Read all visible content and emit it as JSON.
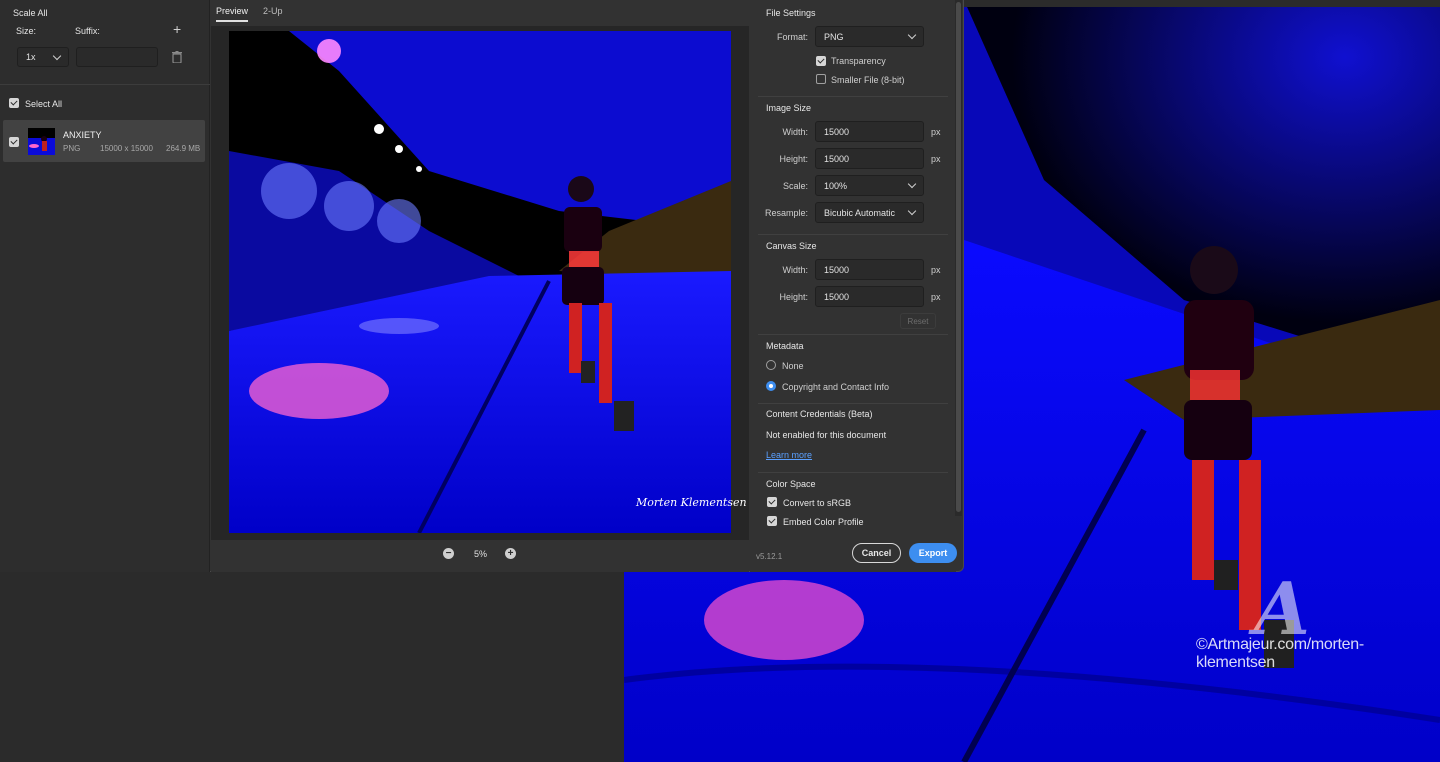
{
  "watermark": "©Artmajeur.com/morten-klementsen",
  "left_panel": {
    "scale_all": "Scale All",
    "size_label": "Size:",
    "suffix_label": "Suffix:",
    "size_value": "1x",
    "suffix_value": "",
    "select_all": "Select All",
    "asset": {
      "name": "ANXIETY",
      "format": "PNG",
      "dimensions": "15000 x 15000",
      "filesize": "264.9 MB"
    }
  },
  "tabs": [
    "Preview",
    "2-Up"
  ],
  "zoom": "5%",
  "signature": "Morten Klementsen",
  "file_settings": {
    "title": "File Settings",
    "format_label": "Format:",
    "format_value": "PNG",
    "transparency": "Transparency",
    "smaller_file": "Smaller File (8-bit)"
  },
  "image_size": {
    "title": "Image Size",
    "width_label": "Width:",
    "width_value": "15000",
    "height_label": "Height:",
    "height_value": "15000",
    "unit": "px",
    "scale_label": "Scale:",
    "scale_value": "100%",
    "resample_label": "Resample:",
    "resample_value": "Bicubic Automatic"
  },
  "canvas_size": {
    "title": "Canvas Size",
    "width_label": "Width:",
    "width_value": "15000",
    "height_label": "Height:",
    "height_value": "15000",
    "unit": "px",
    "reset": "Reset"
  },
  "metadata": {
    "title": "Metadata",
    "none": "None",
    "copyright": "Copyright and Contact Info"
  },
  "content_credentials": {
    "title": "Content Credentials (Beta)",
    "status": "Not enabled for this document",
    "learn_more": "Learn more"
  },
  "color_space": {
    "title": "Color Space",
    "convert": "Convert to sRGB",
    "embed": "Embed Color Profile"
  },
  "footer": {
    "version": "v5.12.1",
    "cancel": "Cancel",
    "export": "Export"
  },
  "colors": {
    "accent": "#3d8ef0",
    "image_blue": "#1a1aff"
  }
}
